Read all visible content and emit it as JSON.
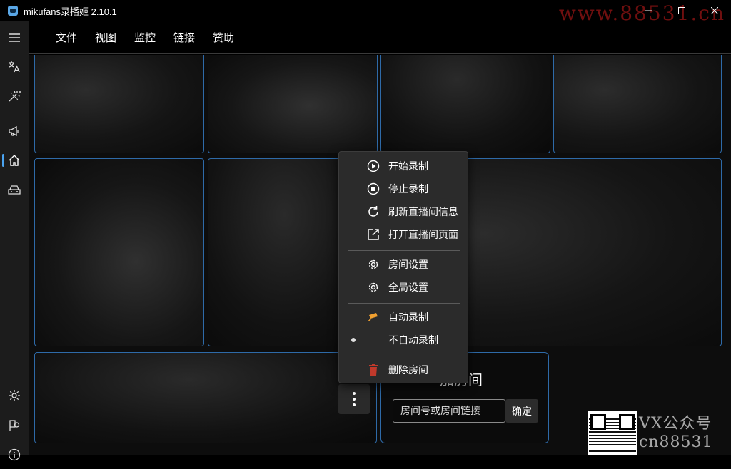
{
  "window": {
    "title": "mikufans录播姬 2.10.1",
    "watermark_top": "www.88531.cn"
  },
  "rail": {
    "icons": [
      "menu-icon",
      "translate-icon",
      "magic-wand-icon",
      "megaphone-icon",
      "home-icon",
      "toolbox-icon",
      "settings-icon",
      "pin-search-icon",
      "info-icon"
    ],
    "active": "home-icon",
    "accent": "#4aa3f0"
  },
  "menubar": {
    "items": [
      "文件",
      "视图",
      "监控",
      "链接",
      "赞助"
    ]
  },
  "add_room": {
    "title": "添加房间",
    "title_visible": "加房间",
    "input_placeholder": "房间号或房间链接",
    "confirm_label": "确定"
  },
  "context_menu": {
    "start_record": "开始录制",
    "stop_record": "停止录制",
    "refresh_info": "刷新直播间信息",
    "open_page": "打开直播间页面",
    "room_settings": "房间设置",
    "global_settings": "全局设置",
    "auto_record": "自动录制",
    "no_auto_record": "不自动录制",
    "delete_room": "删除房间",
    "auto_record_icon_color": "#f0a030",
    "delete_icon_color": "#c0392b"
  },
  "watermark_bottom": {
    "line1": "VX公众号",
    "line2": "cn88531"
  },
  "colors": {
    "card_border": "#2e6aa8",
    "menu_bg": "#2b2b2b"
  }
}
